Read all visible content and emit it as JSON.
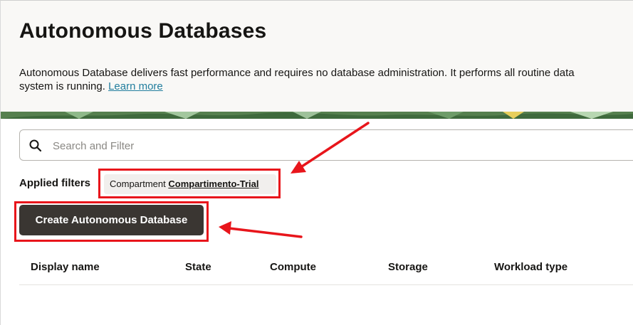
{
  "header": {
    "title": "Autonomous Databases",
    "description_line1": "Autonomous Database delivers fast performance and requires no database administration. It performs all routine data",
    "description_line2": "system is running.",
    "learn_more": "Learn more"
  },
  "search": {
    "placeholder": "Search and Filter",
    "icon": "search-icon"
  },
  "filters": {
    "applied_label": "Applied filters",
    "chip_key": "Compartment",
    "chip_value": "Compartimento-Trial"
  },
  "actions": {
    "create_label": "Create Autonomous Database"
  },
  "table": {
    "columns": [
      "Display name",
      "State",
      "Compute",
      "Storage",
      "Workload type"
    ]
  },
  "colors": {
    "annotation_red": "#e8151b",
    "primary_button": "#3a3632",
    "link": "#227e9e",
    "header_bg": "#f9f8f6"
  }
}
